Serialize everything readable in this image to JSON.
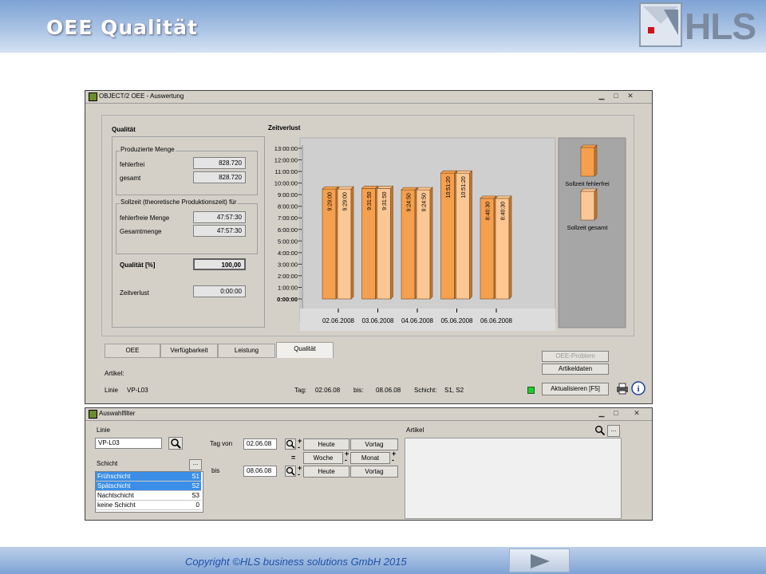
{
  "slide": {
    "title": "OEE Qualität",
    "logo_text": "HLS",
    "copyright": "Copyright ©HLS business solutions GmbH 2015"
  },
  "main_window": {
    "title": "OBJECT/2 OEE - Auswertung",
    "qualitaet_heading": "Qualität",
    "produzierte_menge": {
      "legend": "Produzierte Menge",
      "fehlerfrei_label": "fehlerfrei",
      "fehlerfrei_value": "828.720",
      "gesamt_label": "gesamt",
      "gesamt_value": "828.720"
    },
    "sollzeit": {
      "legend": "Sollzeit (theoretische Produktionszeit) für",
      "fehlerfreie_label": "fehlerfreie Menge",
      "fehlerfreie_value": "47:57:30",
      "gesamtmenge_label": "Gesamtmenge",
      "gesamtmenge_value": "47:57:30"
    },
    "qualitaet_label": "Qualität [%]",
    "qualitaet_value": "100,00",
    "zeitverlust_label": "Zeitverlust",
    "zeitverlust_value": "0:00:00",
    "tabs": [
      "OEE",
      "Verfügbarkeit",
      "Leistung",
      "Qualität"
    ],
    "active_tab": 3,
    "buttons": {
      "oee_problem": "OEE-Problem",
      "artikeldaten": "Artikeldaten",
      "aktualisieren": "Aktualisieren [F5]"
    },
    "status": {
      "artikel_label": "Artikel:",
      "linie_label": "Linie",
      "linie_value": "VP-L03",
      "tag_label": "Tag:",
      "tag_value": "02.06.08",
      "bis_label": "bis:",
      "bis_value": "08.06.08",
      "schicht_label": "Schicht:",
      "schicht_value": "S1, S2"
    }
  },
  "chart_data": {
    "type": "bar",
    "title": "Zeitverlust",
    "categories": [
      "02.06.2008",
      "03.06.2008",
      "04.06.2008",
      "05.06.2008",
      "06.06.2008"
    ],
    "series": [
      {
        "name": "Sollzeit fehlerfrei",
        "values_hours": [
          9.4833,
          9.5306,
          9.4139,
          10.8556,
          8.675
        ],
        "labels": [
          "9:29:00",
          "9:31:50",
          "9:24:50",
          "10:51:20",
          "8:40:30"
        ],
        "color": "#f5a04e"
      },
      {
        "name": "Sollzeit gesamt",
        "values_hours": [
          9.4833,
          9.5306,
          9.4139,
          10.8556,
          8.675
        ],
        "labels": [
          "9:29:00",
          "9:31:50",
          "9:24:50",
          "10:51:20",
          "8:40:30"
        ],
        "color": "#fbc794"
      }
    ],
    "y_ticks": [
      "0:00:00",
      "1:00:00",
      "2:00:00",
      "3:00:00",
      "4:00:00",
      "5:00:00",
      "6:00:00",
      "7:00:00",
      "8:00:00",
      "9:00:00",
      "10:00:00",
      "11:00:00",
      "12:00:00",
      "13:00:00"
    ],
    "ylim": [
      0,
      13
    ],
    "legend_position": "right"
  },
  "filter_window": {
    "title": "Auswahlfilter",
    "linie_label": "Linie",
    "linie_value": "VP-L03",
    "schicht_label": "Schicht",
    "schicht_button": "...",
    "schichten": [
      {
        "name": "Frühschicht",
        "code": "S1",
        "selected": true
      },
      {
        "name": "Spätschicht",
        "code": "S2",
        "selected": true
      },
      {
        "name": "Nachtschicht",
        "code": "S3",
        "selected": false
      },
      {
        "name": "keine Schicht",
        "code": "0",
        "selected": false
      }
    ],
    "tag_von_label": "Tag von",
    "tag_von_value": "02.06.08",
    "bis_label": "bis",
    "bis_value": "08.06.08",
    "plus": "+",
    "minus": "-",
    "equals": "=",
    "heute": "Heute",
    "vortag": "Vortag",
    "woche": "Woche",
    "monat": "Monat",
    "artikel_label": "Artikel",
    "artikel_button": "..."
  }
}
